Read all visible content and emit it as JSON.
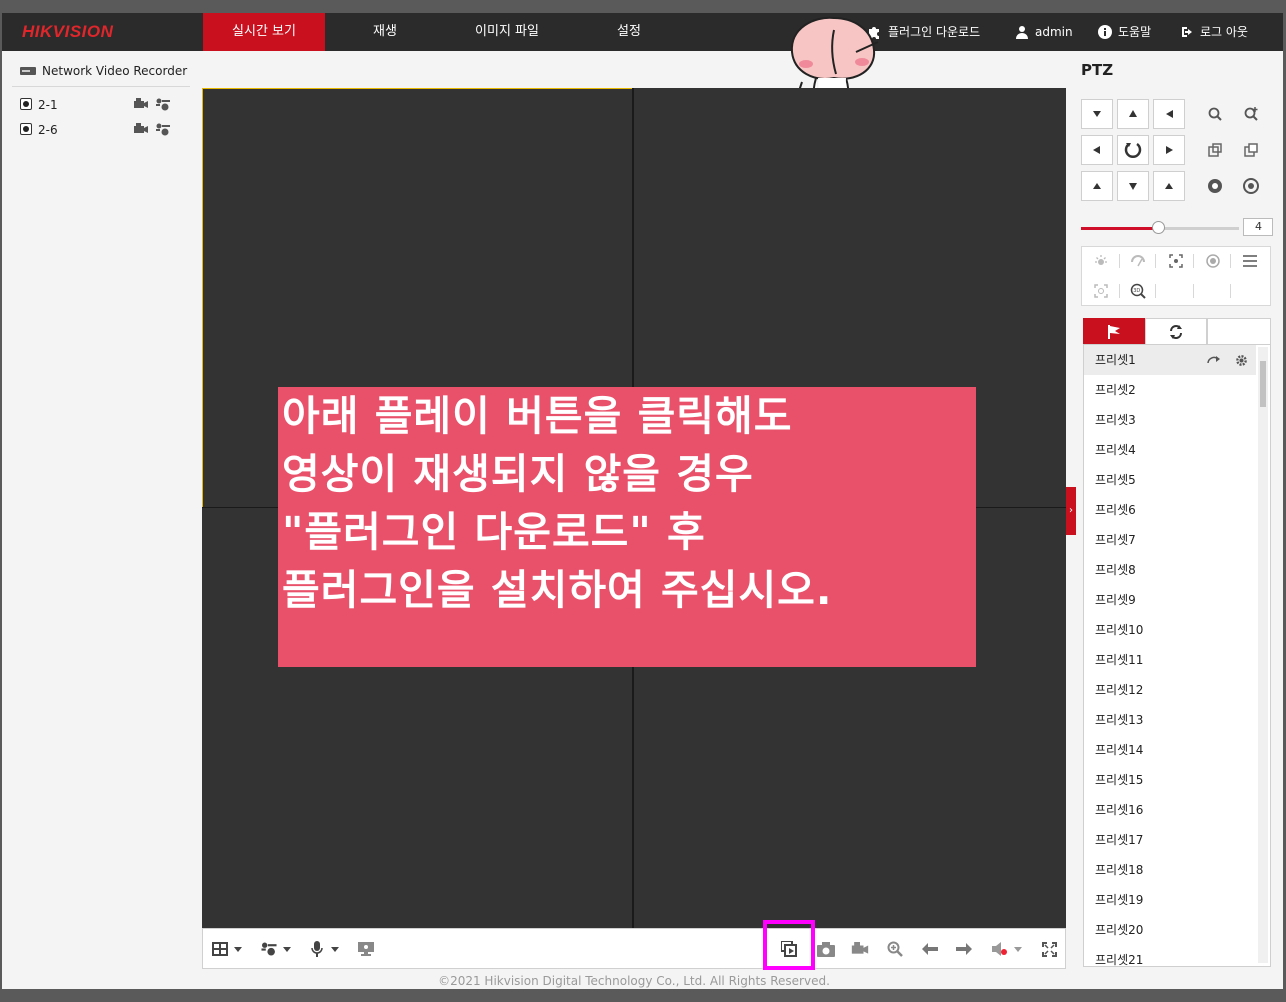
{
  "header": {
    "logo": "HIKVISION",
    "tabs": [
      {
        "label": "실시간 보기",
        "active": true
      },
      {
        "label": "재생",
        "active": false
      },
      {
        "label": "이미지 파일",
        "active": false
      },
      {
        "label": "설정",
        "active": false
      }
    ],
    "plugin_download": "플러그인 다운로드",
    "user": "admin",
    "help": "도움말",
    "logout": "로그 아웃"
  },
  "device_tree": {
    "root": "Network Video Recorder",
    "channels": [
      {
        "label": "2-1"
      },
      {
        "label": "2-6"
      }
    ]
  },
  "notice": {
    "lines": [
      "아래 플레이 버튼을 클릭해도",
      "영상이 재생되지 않을 경우",
      "\"플러그인 다운로드\" 후",
      "플러그인을 설치하여 주십시오."
    ]
  },
  "footer": {
    "copyright": "©2021 Hikvision Digital Technology Co., Ltd. All Rights Reserved."
  },
  "ptz": {
    "title": "PTZ",
    "speed_value": "4",
    "speed_level": 0.5,
    "presets": [
      "프리셋1",
      "프리셋2",
      "프리셋3",
      "프리셋4",
      "프리셋5",
      "프리셋6",
      "프리셋7",
      "프리셋8",
      "프리셋9",
      "프리셋10",
      "프리셋11",
      "프리셋12",
      "프리셋13",
      "프리셋14",
      "프리셋15",
      "프리셋16",
      "프리셋17",
      "프리셋18",
      "프리셋19",
      "프리셋20",
      "프리셋21"
    ]
  },
  "colors": {
    "accent": "#c8101e",
    "header_bg": "#2b2b2b",
    "notice_bg": "#e9506a",
    "highlight": "#ff00ff",
    "video_bg": "#333333"
  }
}
